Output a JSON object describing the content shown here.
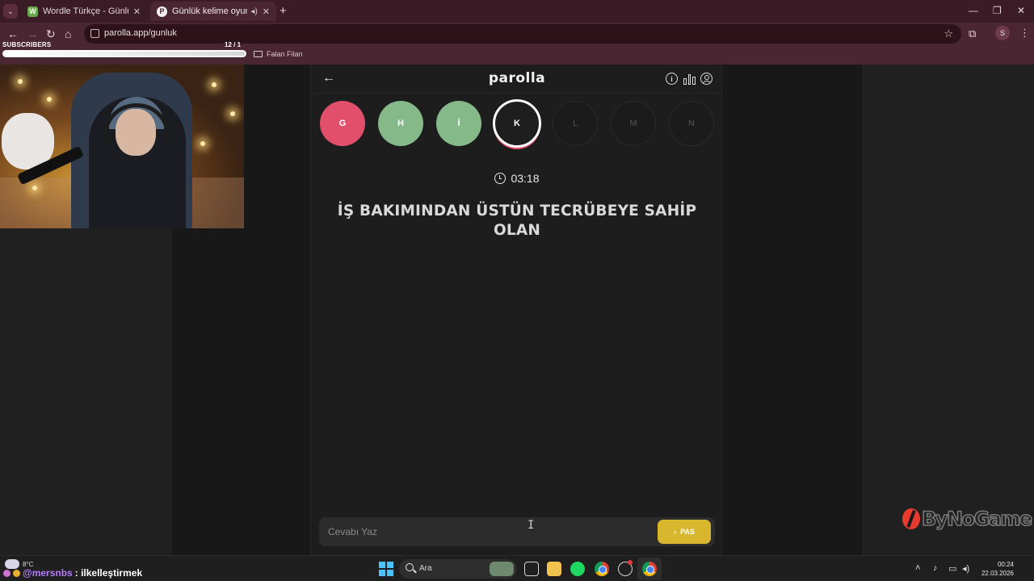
{
  "browser": {
    "tabs": [
      {
        "title": "Wordle Türkçe - Günlük Kelime",
        "favicon": "W",
        "active": false
      },
      {
        "title": "Günlük kelime oyunu - parolla",
        "favicon": "P",
        "active": true
      }
    ],
    "url": "parolla.app/gunluk",
    "bookmark_folder": "Falan Filan",
    "profile_initial": "S"
  },
  "overlay": {
    "subscribers_label": "SUBSCRIBERS",
    "subscribers_count": "12  / 1",
    "subscribers_progress": 1.0
  },
  "game": {
    "logo": "parolla",
    "letters": [
      {
        "char": "G",
        "state": "wrong"
      },
      {
        "char": "H",
        "state": "right"
      },
      {
        "char": "İ",
        "state": "right"
      },
      {
        "char": "K",
        "state": "current"
      },
      {
        "char": "L",
        "state": "pending"
      },
      {
        "char": "M",
        "state": "pending"
      },
      {
        "char": "N",
        "state": "pending"
      }
    ],
    "timer": "03:18",
    "question": "İŞ BAKIMINDAN ÜSTÜN TECRÜBEYE SAHİP OLAN",
    "input_placeholder": "Cevabı Yaz",
    "input_value": "",
    "pass_button": "PAS"
  },
  "sponsor": "ByNoGame",
  "taskbar": {
    "weather_temp": "8°C",
    "chat_user": "@mersnbs",
    "chat_message": ": ilkelleştirmek",
    "search_label": "Ara",
    "time": "00:24",
    "date": "22.03.2026"
  },
  "colors": {
    "wrong": "#e24f6b",
    "right": "#86b98a",
    "pass": "#d8b62d",
    "chrome_frame": "#4a2532"
  }
}
